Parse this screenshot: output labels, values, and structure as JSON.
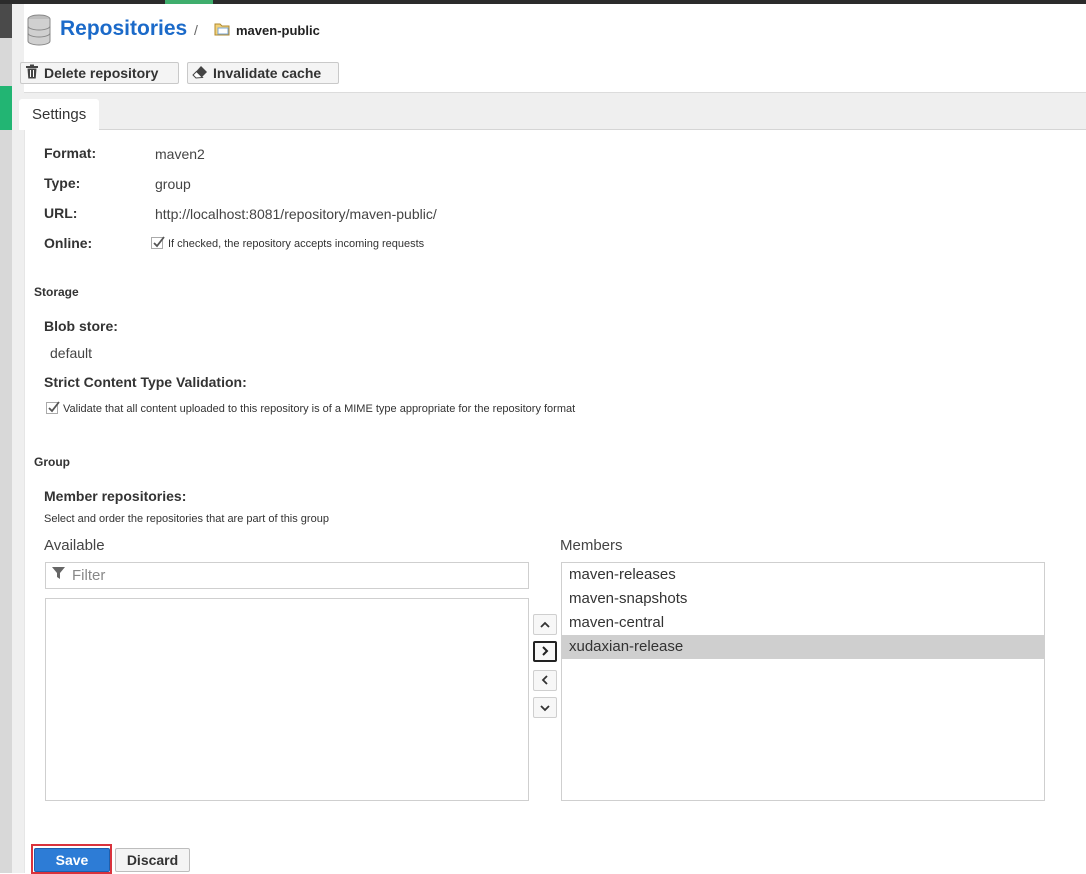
{
  "header": {
    "title": "Repositories",
    "separator": "/",
    "breadcrumb": "maven-public"
  },
  "toolbar": {
    "delete_label": "Delete repository",
    "invalidate_label": "Invalidate cache"
  },
  "tabs": [
    {
      "label": "Settings"
    }
  ],
  "settings": {
    "format_label": "Format:",
    "format_value": "maven2",
    "type_label": "Type:",
    "type_value": "group",
    "url_label": "URL:",
    "url_value": "http://localhost:8081/repository/maven-public/",
    "online_label": "Online:",
    "online_checked": true,
    "online_help": "If checked, the repository accepts incoming requests"
  },
  "storage": {
    "section_title": "Storage",
    "blob_label": "Blob store:",
    "blob_value": "default",
    "strict_label": "Strict Content Type Validation:",
    "strict_checked": true,
    "strict_help": "Validate that all content uploaded to this repository is of a MIME type appropriate for the repository format"
  },
  "group": {
    "section_title": "Group",
    "members_label": "Member repositories:",
    "members_help": "Select and order the repositories that are part of this group",
    "available_label": "Available",
    "filter_placeholder": "Filter",
    "members_title": "Members",
    "available_items": [],
    "members": [
      {
        "name": "maven-releases",
        "selected": false
      },
      {
        "name": "maven-snapshots",
        "selected": false
      },
      {
        "name": "maven-central",
        "selected": false
      },
      {
        "name": "xudaxian-release",
        "selected": true
      }
    ]
  },
  "actions": {
    "save_label": "Save",
    "discard_label": "Discard"
  },
  "colors": {
    "title_blue": "#1b6ac9",
    "save_blue": "#2d7cd6",
    "nav_green": "#22b573",
    "highlight_red": "#d9323c"
  },
  "icons": {
    "header": "database-icon",
    "breadcrumb": "folder-icon",
    "delete": "trash-icon",
    "invalidate": "eraser-icon",
    "filter": "filter-icon"
  }
}
